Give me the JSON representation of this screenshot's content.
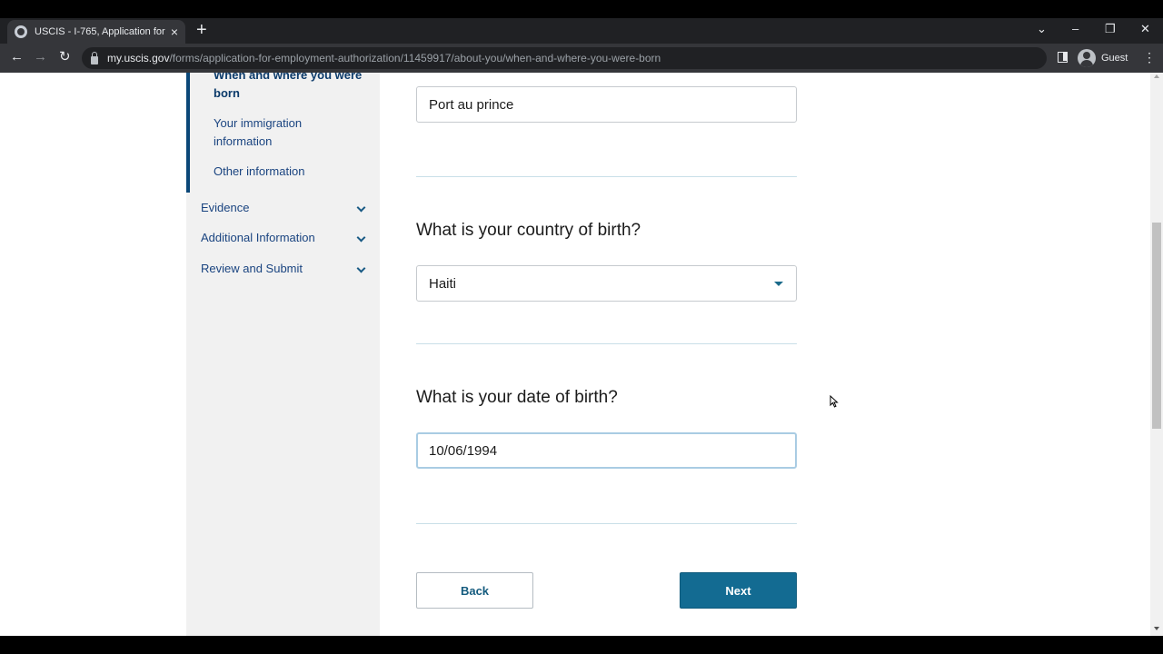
{
  "browser": {
    "tab_title": "USCIS - I-765, Application for Em",
    "new_tab_glyph": "+",
    "tab_close_glyph": "×",
    "url_host": "my.uscis.gov",
    "url_path": "/forms/application-for-employment-authorization/11459917/about-you/when-and-where-you-were-born",
    "profile_label": "Guest",
    "back_glyph": "←",
    "forward_glyph": "→",
    "reload_glyph": "↻",
    "menu_glyph": "⋮",
    "tablist_glyph": "⌄",
    "minimize_glyph": "–",
    "restore_glyph": "❐",
    "close_glyph": "✕"
  },
  "sidebar": {
    "subnav": [
      {
        "label": "When and where you were born",
        "active": true
      },
      {
        "label": "Your immigration information",
        "active": false
      },
      {
        "label": "Other information",
        "active": false
      }
    ],
    "sections": [
      {
        "label": "Evidence"
      },
      {
        "label": "Additional Information"
      },
      {
        "label": "Review and Submit"
      }
    ]
  },
  "form": {
    "city_value": "Port au prince",
    "country_question": "What is your country of birth?",
    "country_value": "Haiti",
    "dob_question": "What is your date of birth?",
    "dob_value": "10/06/1994",
    "back_label": "Back",
    "next_label": "Next"
  },
  "colors": {
    "primary_button": "#136b92",
    "nav_text": "#1a4480",
    "sidebar_bg": "#f1f1f1"
  }
}
